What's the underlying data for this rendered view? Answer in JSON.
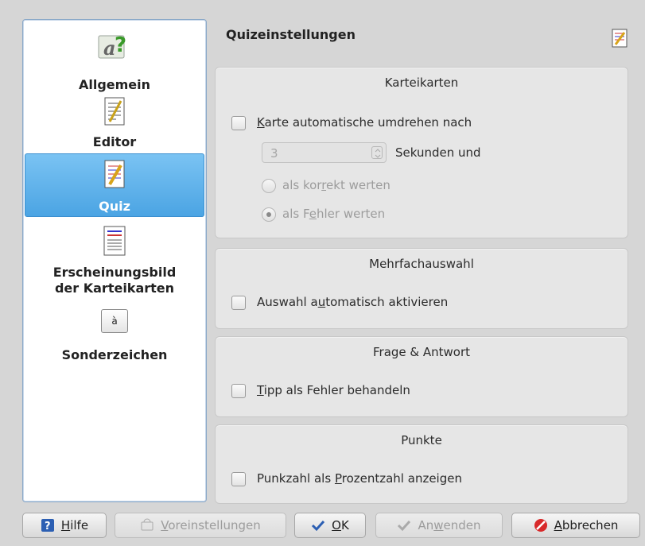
{
  "sidebar": {
    "items": [
      {
        "label": "Allgemein",
        "icon": "general-help-icon"
      },
      {
        "label": "Editor",
        "icon": "editor-icon"
      },
      {
        "label": "Quiz",
        "icon": "quiz-icon",
        "active": true
      },
      {
        "label_line1": "Erscheinungsbild",
        "label_line2": "der Karteikarten",
        "icon": "card-appearance-icon"
      },
      {
        "label": "Sonderzeichen",
        "icon": "special-chars-icon",
        "glyph": "à"
      }
    ]
  },
  "page": {
    "title": "Quizeinstellungen"
  },
  "groups": {
    "flashcards": {
      "title": "Karteikarten",
      "auto_flip_pre": "",
      "auto_flip_u": "K",
      "auto_flip_post": "arte automatische umdrehen nach",
      "auto_flip_checked": false,
      "seconds_value": "3",
      "seconds_label": "Sekunden und",
      "radio_correct_pre": "als kor",
      "radio_correct_u": "r",
      "radio_correct_post": "ekt werten",
      "radio_error_pre": "als F",
      "radio_error_u": "e",
      "radio_error_post": "hler werten",
      "selected": "error"
    },
    "multiple_choice": {
      "title": "Mehrfachauswahl",
      "auto_select_pre": "Auswahl a",
      "auto_select_u": "u",
      "auto_select_post": "tomatisch aktivieren",
      "checked": false
    },
    "qa": {
      "title": "Frage & Antwort",
      "typo_u": "T",
      "typo_post": "ipp als Fehler behandeln",
      "checked": false
    },
    "points": {
      "title": "Punkte",
      "percent_pre": "Punkzahl als ",
      "percent_u": "P",
      "percent_post": "rozentzahl anzeigen",
      "checked": false
    }
  },
  "buttons": {
    "help_u": "H",
    "help_post": "ilfe",
    "defaults_u": "V",
    "defaults_post": "oreinstellungen",
    "ok_u": "O",
    "ok_post": "K",
    "apply_pre": "An",
    "apply_u": "w",
    "apply_post": "enden",
    "cancel_u": "A",
    "cancel_post": "bbrechen"
  },
  "colors": {
    "accent": "#4ba4e3",
    "cancel_red": "#d8292a",
    "help_blue": "#2c5fb3"
  }
}
